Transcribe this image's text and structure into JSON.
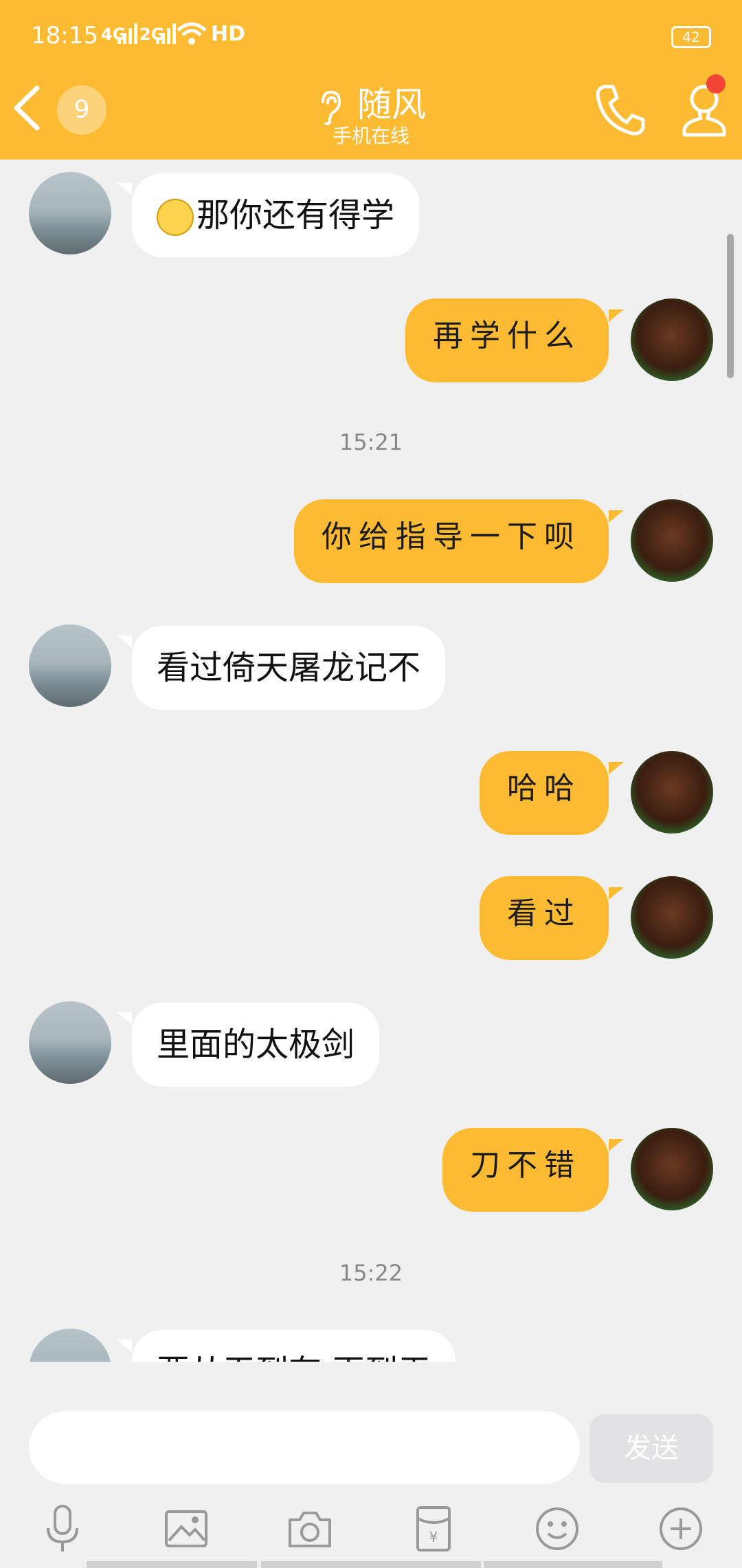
{
  "status_bar": {
    "time": "18:15",
    "net1": "4G",
    "net2": "2G",
    "hd": "HD",
    "battery": "42"
  },
  "header": {
    "back_count": "9",
    "contact_name": "随风",
    "contact_status": "手机在线"
  },
  "messages": [
    {
      "side": "left",
      "text": "那你还有得学",
      "has_emoji": true
    },
    {
      "side": "right",
      "text": "再学什么"
    },
    {
      "type": "time",
      "text": "15:21"
    },
    {
      "side": "right",
      "text": "你给指导一下呗"
    },
    {
      "side": "left",
      "text": "看过倚天屠龙记不"
    },
    {
      "side": "right",
      "text": "哈哈"
    },
    {
      "side": "right",
      "text": "看过"
    },
    {
      "side": "left",
      "text": "里面的太极剑"
    },
    {
      "side": "right",
      "text": "刀不错"
    },
    {
      "type": "time",
      "text": "15:22"
    },
    {
      "side": "left",
      "text": "要从无到有 再到无"
    }
  ],
  "input": {
    "value": "",
    "placeholder": "",
    "send_label": "发送"
  },
  "toolbar": [
    "mic-icon",
    "image-icon",
    "camera-icon",
    "red-packet-icon",
    "emoji-icon",
    "plus-icon"
  ],
  "colors": {
    "accent": "#fdbb33",
    "background": "#f0f0f0",
    "send_disabled": "#e2e2e4"
  }
}
